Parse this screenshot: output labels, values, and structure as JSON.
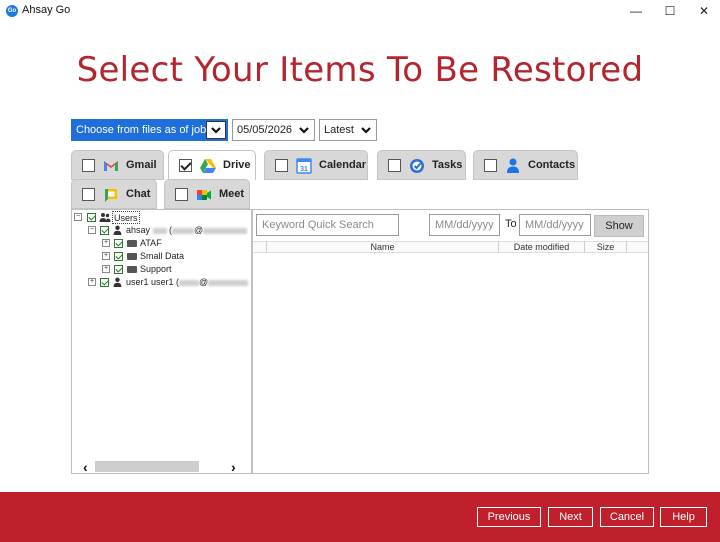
{
  "window": {
    "app_icon_text": "Go",
    "title": "Ahsay Go",
    "min_glyph": "—",
    "max_glyph": "☐",
    "close_glyph": "✕"
  },
  "heading": "Select Your Items To Be Restored",
  "selectors": {
    "job_mode": "Choose from files as of job",
    "date": "05/05/2026",
    "version": "Latest"
  },
  "tabs": [
    {
      "label": "Gmail",
      "checked": false,
      "icon": "gmail-icon"
    },
    {
      "label": "Drive",
      "checked": true,
      "icon": "google-drive-icon"
    },
    {
      "label": "Calendar",
      "checked": false,
      "icon": "calendar-icon"
    },
    {
      "label": "Tasks",
      "checked": false,
      "icon": "tasks-icon"
    },
    {
      "label": "Contacts",
      "checked": false,
      "icon": "contacts-icon"
    },
    {
      "label": "Chat",
      "checked": false,
      "icon": "chat-icon"
    },
    {
      "label": "Meet",
      "checked": false,
      "icon": "meet-icon"
    }
  ],
  "tree": {
    "root": "Users",
    "user1_name": "ahsay",
    "user1_email_suffix": "@",
    "folders": [
      "ATAF",
      "Small Data",
      "Support"
    ],
    "user2_name": "user1 user1 (",
    "user2_email_suffix": "@"
  },
  "search": {
    "keyword_placeholder": "Keyword Quick Search",
    "from_placeholder": "MM/dd/yyyy",
    "to_label": "To",
    "to_placeholder": "MM/dd/yyyy",
    "show_label": "Show"
  },
  "columns": [
    "Name",
    "Date modified",
    "Size"
  ],
  "scroll": {
    "left_arrow": "‹",
    "right_arrow": "›"
  },
  "footer": {
    "previous": "Previous",
    "next": "Next",
    "cancel": "Cancel",
    "help": "Help"
  },
  "colors": {
    "brand_red": "#c0202c",
    "heading_red": "#b3262f",
    "selection_blue": "#1e6fd9"
  }
}
